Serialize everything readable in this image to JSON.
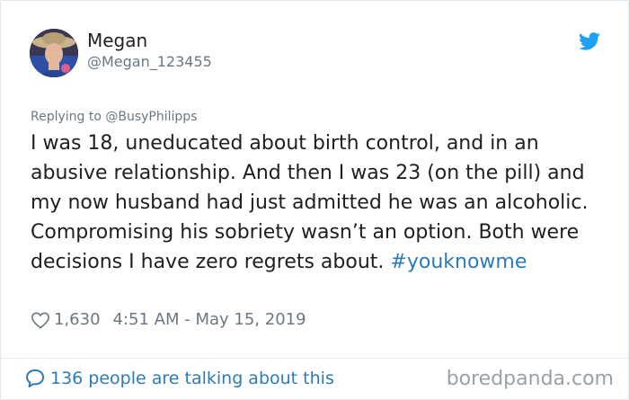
{
  "user": {
    "display_name": "Megan",
    "handle": "@Megan_123455",
    "avatar_icon": "profile-photo"
  },
  "replying_to": "Replying to @BusyPhilipps",
  "tweet": {
    "text": "I was 18, uneducated about birth control, and in an abusive relationship. And then I was 23 (on the pill) and my now husband had just admitted he was an alcoholic. Compromising his sobriety wasn’t an option. Both were decisions I have zero regrets about. ",
    "hashtag": "#youknowme",
    "likes": "1,630",
    "timestamp": "4:51 AM - May 15, 2019"
  },
  "footer": {
    "conversation": "136 people are talking about this",
    "watermark": "boredpanda.com"
  },
  "colors": {
    "link": "#2b7bb9",
    "twitter_blue": "#1da1f2",
    "muted": "#697882",
    "border": "#e1e8ed"
  },
  "icons": {
    "brand": "twitter-bird-icon",
    "like": "heart-icon",
    "reply": "speech-bubble-icon"
  }
}
